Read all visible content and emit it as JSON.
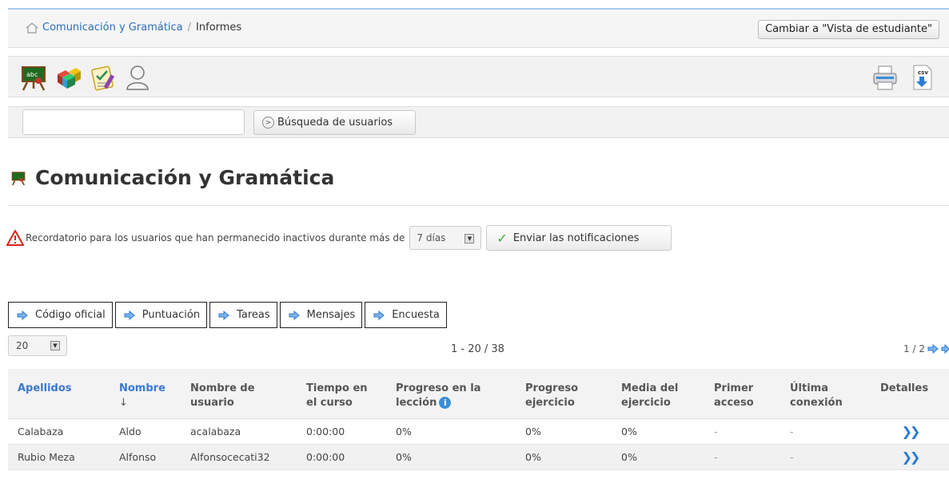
{
  "breadcrumb": {
    "course": "Comunicación y Gramática",
    "separator": "/",
    "current": "Informes"
  },
  "header": {
    "switch_view_label": "Cambiar a \"Vista de estudiante\""
  },
  "search": {
    "value": "",
    "button_label": "Búsqueda de usuarios"
  },
  "page": {
    "title": "Comunicación y Gramática"
  },
  "reminder": {
    "text": "Recordatorio para los usuarios que han permanecido inactivos durante más de",
    "days_selected": "7 días",
    "send_label": "Enviar las notificaciones"
  },
  "tabs": [
    "Código oficial",
    "Puntuación",
    "Tareas",
    "Mensajes",
    "Encuesta"
  ],
  "pagination": {
    "per_page": "20",
    "range": "1 - 20 / 38",
    "page_info": "1 / 2"
  },
  "table": {
    "headers": {
      "lastname": "Apellidos",
      "firstname": "Nombre",
      "sort_indicator": "↓",
      "username_l1": "Nombre de",
      "username_l2": "usuario",
      "time_l1": "Tiempo en",
      "time_l2": "el curso",
      "progress_l1": "Progreso en la",
      "progress_l2": "lección",
      "exercise_l1": "Progreso",
      "exercise_l2": "ejercicio",
      "avg_l1": "Media del",
      "avg_l2": "ejercicio",
      "first_l1": "Primer",
      "first_l2": "acceso",
      "last_l1": "Última",
      "last_l2": "conexión",
      "details": "Detalles"
    },
    "rows": [
      {
        "lastname": "Calabaza",
        "firstname": "Aldo",
        "username": "acalabaza",
        "time": "0:00:00",
        "progress": "0%",
        "exercise": "0%",
        "avg": "0%",
        "first": "-",
        "last": "-"
      },
      {
        "lastname": "Rubio Meza",
        "firstname": "Alfonso",
        "username": "Alfonsocecati32",
        "time": "0:00:00",
        "progress": "0%",
        "exercise": "0%",
        "avg": "0%",
        "first": "-",
        "last": "-"
      }
    ]
  },
  "colors": {
    "link": "#3a78d0",
    "accent_blue": "#2a7ad6",
    "warning_red": "#d9261c",
    "check_green": "#3caa3c"
  }
}
